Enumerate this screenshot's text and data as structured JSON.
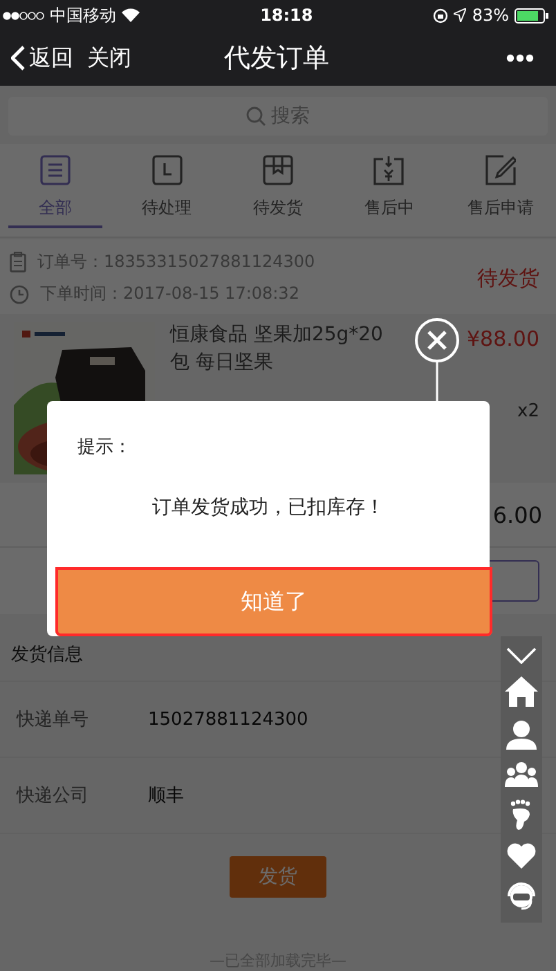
{
  "status_bar": {
    "carrier": "中国移动",
    "time": "18:18",
    "battery": "83%"
  },
  "nav": {
    "back": "返回",
    "close": "关闭",
    "title": "代发订单"
  },
  "search": {
    "placeholder": "搜索"
  },
  "tabs": [
    {
      "label": "全部",
      "selected": true
    },
    {
      "label": "待处理",
      "selected": false
    },
    {
      "label": "待发货",
      "selected": false
    },
    {
      "label": "售后中",
      "selected": false
    },
    {
      "label": "售后申请",
      "selected": false
    }
  ],
  "order": {
    "number": "订单号：18353315027881124300",
    "time": "下单时间：2017-08-15 17:08:32",
    "status": "待发货"
  },
  "product": {
    "title": "恒康食品 坚果加25g*20包 每日坚果",
    "price": "¥88.00",
    "quantity": "x2"
  },
  "total": "6.00",
  "shipping": {
    "heading": "发货信息",
    "rows": [
      {
        "label": "快递单号",
        "value": "15027881124300"
      },
      {
        "label": "快递公司",
        "value": "顺丰"
      }
    ],
    "button": "发货"
  },
  "footer": "—已全部加载完毕—",
  "dialog": {
    "title": "提示：",
    "message": "订单发货成功，已扣库存！",
    "button": "知道了",
    "highlighted": true
  }
}
